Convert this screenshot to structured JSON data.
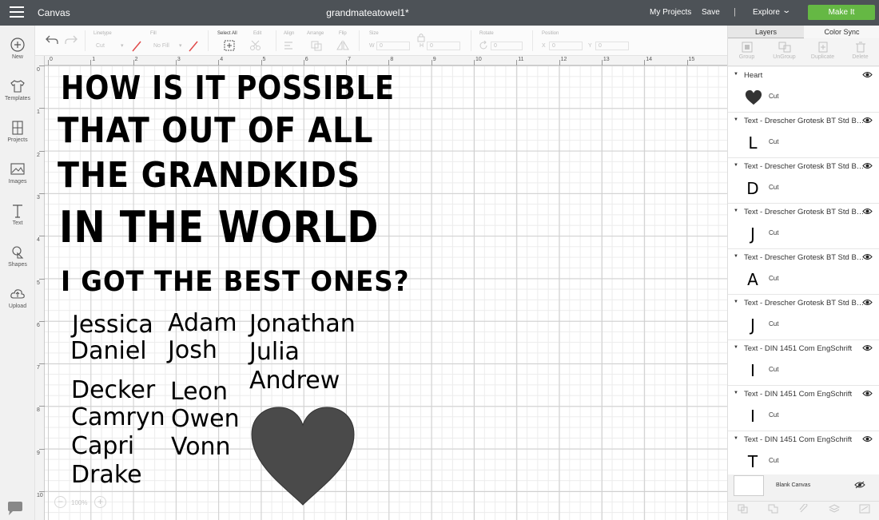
{
  "topbar": {
    "app_name": "Canvas",
    "doc_name": "grandmateatowel1*",
    "my_projects": "My Projects",
    "save": "Save",
    "separator": "|",
    "explore": "Explore",
    "make_it": "Make It",
    "make_it_color": "#65b844"
  },
  "leftbar": {
    "new": "New",
    "templates": "Templates",
    "projects": "Projects",
    "images": "Images",
    "text": "Text",
    "shapes": "Shapes",
    "upload": "Upload"
  },
  "toolbar": {
    "undo_icon": "undo-icon",
    "redo_icon": "redo-icon",
    "linetype_label": "Linetype",
    "linetype_value": "Cut",
    "fill_label": "Fill",
    "fill_value": "No Fill",
    "select_all": "Select All",
    "edit": "Edit",
    "align": "Align",
    "arrange": "Arrange",
    "flip": "Flip",
    "size": "Size",
    "w_label": "W",
    "w_value": "0",
    "h_label": "H",
    "h_value": "0",
    "rotate": "Rotate",
    "rotate_value": "0",
    "position": "Position",
    "x_label": "X",
    "x_value": "0",
    "y_label": "Y",
    "y_value": "0"
  },
  "rulers": {
    "h": [
      "0",
      "1",
      "2",
      "3",
      "4",
      "5",
      "6",
      "7",
      "8",
      "9",
      "10",
      "11",
      "12",
      "13",
      "14",
      "15"
    ],
    "v": [
      "0",
      "1",
      "2",
      "3",
      "4",
      "5",
      "6",
      "7",
      "8",
      "9",
      "10"
    ]
  },
  "canvas": {
    "phrase_lines": [
      "HOW IS IT POSSIBLE",
      "THAT OUT OF ALL",
      "THE GRANDKIDS",
      "IN THE WORLD",
      "I GOT THE BEST ONES?"
    ],
    "names": {
      "col1": [
        "Jessica",
        "Daniel",
        "Decker",
        "Camryn",
        "Capri",
        "Drake"
      ],
      "col2": [
        "Adam",
        "Josh",
        "Leon",
        "Owen",
        "Vonn"
      ],
      "col3": [
        "Jonathan",
        "Julia",
        "Andrew"
      ]
    },
    "heart_color": "#4a4a4a",
    "zoom": "100%"
  },
  "panel": {
    "tab_layers": "Layers",
    "tab_color_sync": "Color Sync",
    "group": "Group",
    "ungroup": "UnGroup",
    "duplicate": "Duplicate",
    "delete": "Delete",
    "layers": [
      {
        "name": "Heart",
        "type": "Cut",
        "glyph": ""
      },
      {
        "name": "Text - Drescher Grotesk BT Std Bold",
        "type": "Cut",
        "glyph": "L"
      },
      {
        "name": "Text - Drescher Grotesk BT Std Bold",
        "type": "Cut",
        "glyph": "D"
      },
      {
        "name": "Text - Drescher Grotesk BT Std Bold",
        "type": "Cut",
        "glyph": "J"
      },
      {
        "name": "Text - Drescher Grotesk BT Std Bold",
        "type": "Cut",
        "glyph": "A"
      },
      {
        "name": "Text - Drescher Grotesk BT Std Bold",
        "type": "Cut",
        "glyph": "J"
      },
      {
        "name": "Text - DIN 1451 Com EngSchrift",
        "type": "Cut",
        "glyph": "I"
      },
      {
        "name": "Text - DIN 1451 Com EngSchrift",
        "type": "Cut",
        "glyph": "I"
      },
      {
        "name": "Text - DIN 1451 Com EngSchrift",
        "type": "Cut",
        "glyph": "T"
      }
    ],
    "blank_canvas": "Blank Canvas",
    "bottom_tools": [
      "Slice",
      "Weld",
      "Attach",
      "Flatten",
      "Contour"
    ]
  }
}
